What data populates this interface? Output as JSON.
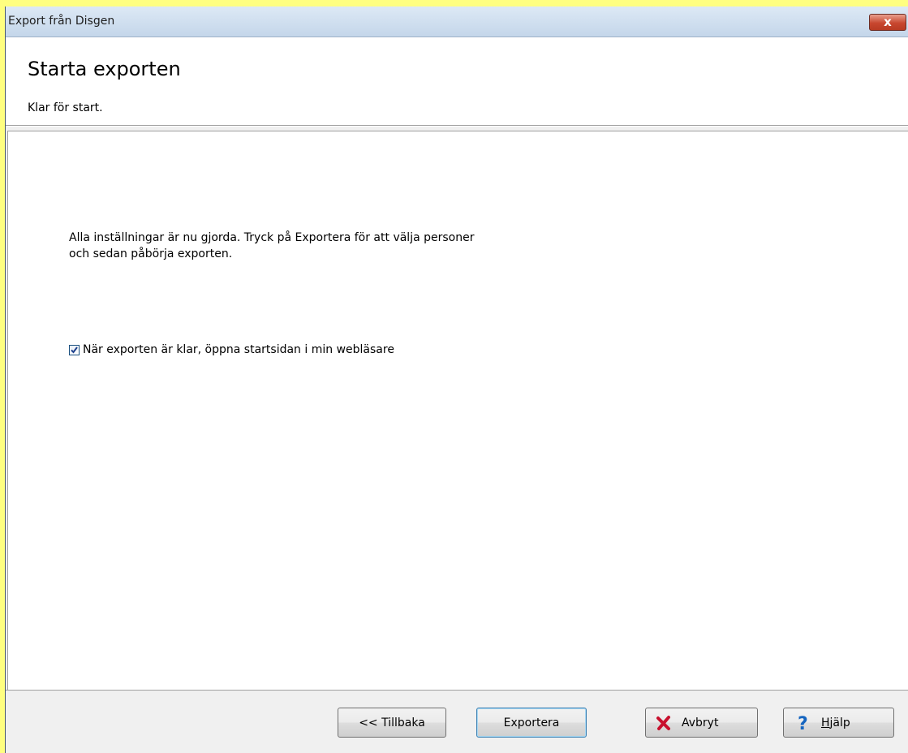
{
  "window": {
    "title": "Export från Disgen",
    "close_label": "x"
  },
  "header": {
    "title": "Starta exporten",
    "subtitle": "Klar för start."
  },
  "content": {
    "info_line1": "Alla inställningar är nu gjorda. Tryck på Exportera för att välja personer",
    "info_line2": "och sedan påbörja exporten.",
    "open_browser_checkbox": {
      "label": "När exporten är klar, öppna startsidan i min webläsare",
      "checked": true
    }
  },
  "footer": {
    "back_label": "<< Tillbaka",
    "export_label": "Exportera",
    "cancel_label": "Avbryt",
    "help_label": "Hjälp"
  },
  "colors": {
    "desktop_background": "#ffff80",
    "cancel_icon": "#c8102e",
    "help_icon": "#1565c0"
  }
}
